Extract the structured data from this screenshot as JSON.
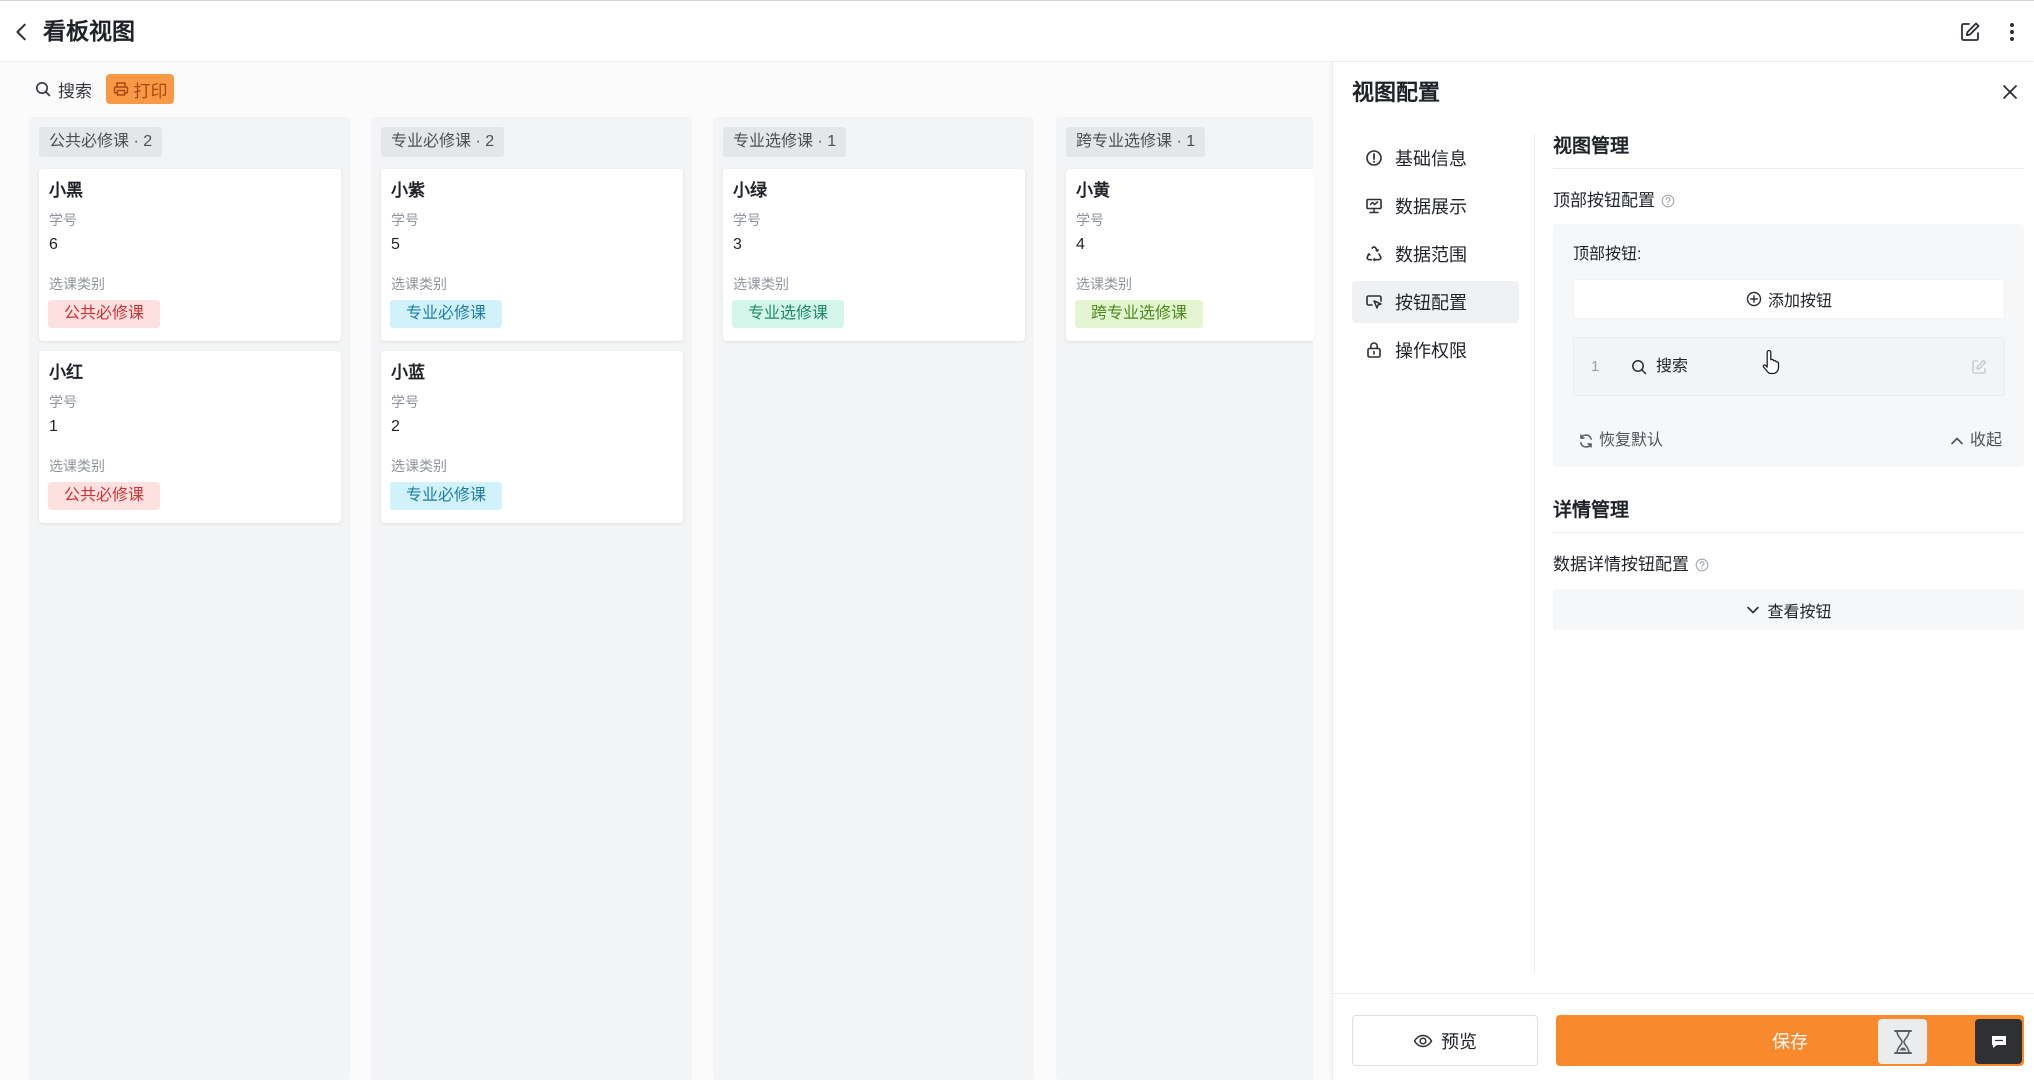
{
  "header": {
    "title": "看板视图",
    "icons": {
      "back": "chevron-left-icon",
      "edit": "edit-icon",
      "more": "more-vertical-icon"
    }
  },
  "toolbar": {
    "search_label": "搜索",
    "search_icon": "search-icon",
    "print_label": "打印",
    "print_icon": "printer-icon"
  },
  "board": {
    "columns": [
      {
        "header": "公共必修课 · 2",
        "cards": [
          {
            "name": "小黑",
            "id_label": "学号",
            "id_value": "6",
            "category_label": "选课类别",
            "category": "公共必修课"
          },
          {
            "name": "小红",
            "id_label": "学号",
            "id_value": "1",
            "category_label": "选课类别",
            "category": "公共必修课"
          }
        ]
      },
      {
        "header": "专业必修课 · 2",
        "cards": [
          {
            "name": "小紫",
            "id_label": "学号",
            "id_value": "5",
            "category_label": "选课类别",
            "category": "专业必修课"
          },
          {
            "name": "小蓝",
            "id_label": "学号",
            "id_value": "2",
            "category_label": "选课类别",
            "category": "专业必修课"
          }
        ]
      },
      {
        "header": "专业选修课 · 1",
        "cards": [
          {
            "name": "小绿",
            "id_label": "学号",
            "id_value": "3",
            "category_label": "选课类别",
            "category": "专业选修课"
          }
        ]
      },
      {
        "header": "跨专业选修课 · 1",
        "cards": [
          {
            "name": "小黄",
            "id_label": "学号",
            "id_value": "4",
            "category_label": "选课类别",
            "category": "跨专业选修课"
          }
        ]
      }
    ]
  },
  "panel": {
    "title": "视图配置",
    "close_icon": "close-icon",
    "nav": [
      {
        "label": "基础信息",
        "icon": "info-icon"
      },
      {
        "label": "数据展示",
        "icon": "display-icon"
      },
      {
        "label": "数据范围",
        "icon": "scope-icon"
      },
      {
        "label": "按钮配置",
        "icon": "button-config-icon",
        "active": true
      },
      {
        "label": "操作权限",
        "icon": "lock-icon"
      }
    ],
    "view_management": {
      "heading": "视图管理",
      "top_buttons_config_label": "顶部按钮配置",
      "top_buttons_label": "顶部按钮:",
      "add_button_label": "添加按钮",
      "buttons": [
        {
          "index": "1",
          "label": "搜索",
          "icon": "search-icon"
        }
      ],
      "restore_label": "恢复默认",
      "collapse_label": "收起"
    },
    "detail_management": {
      "heading": "详情管理",
      "detail_buttons_config_label": "数据详情按钮配置",
      "view_buttons_label": "查看按钮"
    },
    "footer": {
      "preview_label": "预览",
      "save_label": "保存",
      "overlay_icons": [
        "hourglass-icon",
        "chat-icon"
      ]
    }
  },
  "colors": {
    "accent": "#f8892d",
    "print_bg": "#f89a45",
    "print_fg": "#a94712",
    "tags": {
      "public_required": {
        "bg": "#fde1e1",
        "fg": "#cc3434"
      },
      "major_required": {
        "bg": "#d2f2fb",
        "fg": "#1c7ea6"
      },
      "major_elective": {
        "bg": "#d4f5ea",
        "fg": "#1d8c68"
      },
      "cross_major_elective": {
        "bg": "#e3f5d1",
        "fg": "#4c8a1d"
      }
    }
  }
}
